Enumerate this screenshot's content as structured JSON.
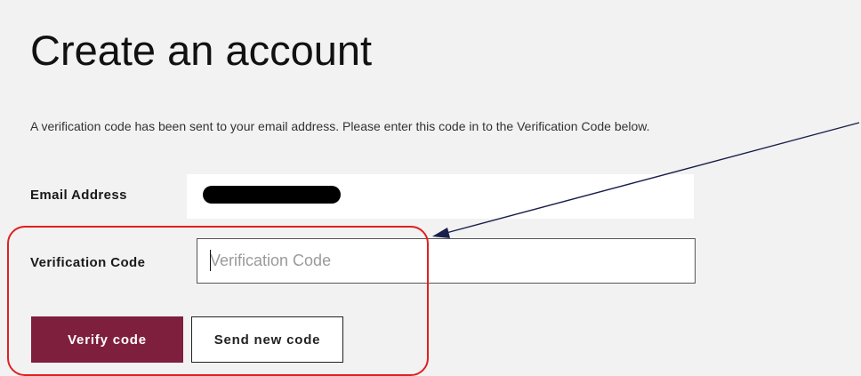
{
  "page": {
    "title": "Create an account",
    "instructions": "A verification code has been sent to your email address. Please enter this code in to the Verification Code below."
  },
  "form": {
    "email": {
      "label": "Email Address",
      "value": ""
    },
    "verification_code": {
      "label": "Verification Code",
      "placeholder": "Verification Code",
      "value": ""
    },
    "buttons": {
      "verify_label": "Verify code",
      "send_new_label": "Send new code"
    }
  },
  "colors": {
    "primary_button": "#7f1f3e",
    "background": "#f2f2f2",
    "annotation": "#e02020",
    "arrow": "#1a1f4a"
  },
  "annotations": {
    "highlight": "red-rounded-rectangle",
    "pointer": "arrow-pointing-to-verification-code-field"
  }
}
